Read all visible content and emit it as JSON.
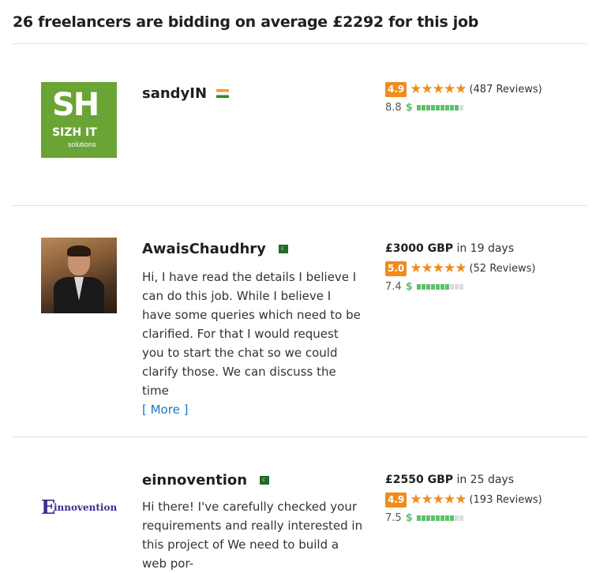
{
  "header": {
    "title": "26 freelancers are bidding on average £2292 for this job"
  },
  "bids": [
    {
      "name": "sandyIN",
      "flag": "india-flag-icon",
      "logo_text_main": "SH",
      "logo_text_sub": "SIZH IT",
      "logo_text_small": "solutions",
      "price": "",
      "days": "",
      "rating": "4.9",
      "reviews": "(487 Reviews)",
      "earnings_score": "8.8",
      "earnings_level": 0.88,
      "description": "",
      "more": ""
    },
    {
      "name": "AwaisChaudhry",
      "flag": "pakistan-flag-icon",
      "price": "£3000 GBP",
      "days": "in 19 days",
      "rating": "5.0",
      "reviews": "(52 Reviews)",
      "earnings_score": "7.4",
      "earnings_level": 0.74,
      "description": "Hi, I have read the details I believe I can do this job. While I believe I have some queries which need to be clarified. For that I would request you to start the chat so we could clarify those. We can discuss the time",
      "more": "[ More ]"
    },
    {
      "name": "einnovention",
      "flag": "pakistan-flag-icon",
      "logo_text_main": "innovention",
      "price": "£2550 GBP",
      "days": "in 25 days",
      "rating": "4.9",
      "reviews": "(193 Reviews)",
      "earnings_score": "7.5",
      "earnings_level": 0.75,
      "description": "Hi there! I've carefully checked your requirements and really interested in this project of We need to build a web por-",
      "more": ""
    }
  ],
  "colors": {
    "accent_orange": "#f18b1c",
    "earnings_green": "#5dc26a",
    "link_blue": "#1a73c8",
    "logo_green": "#6aa434"
  }
}
